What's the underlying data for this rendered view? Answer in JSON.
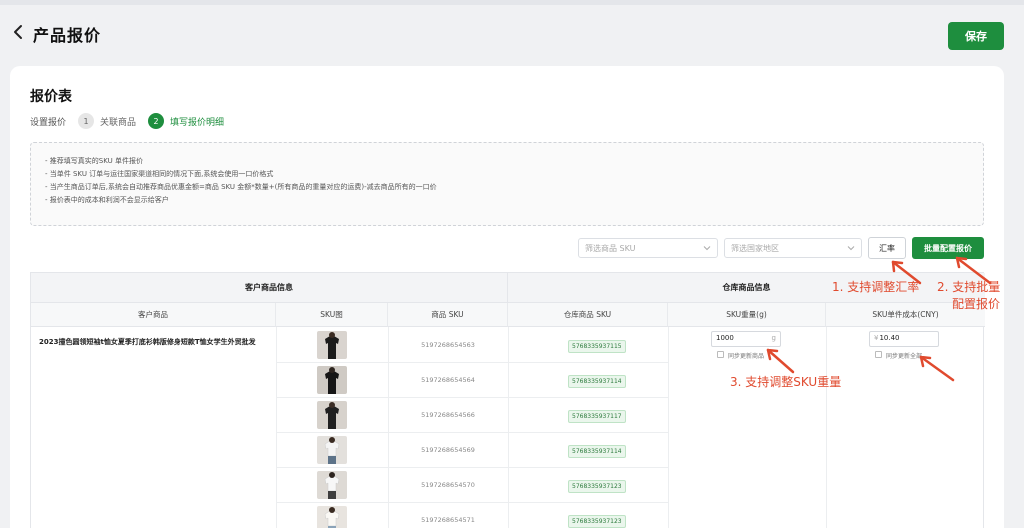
{
  "header": {
    "title": "产品报价",
    "save_label": "保存"
  },
  "card": {
    "title": "报价表",
    "steps": {
      "label": "设置报价",
      "items": [
        {
          "num": "1",
          "label": "关联商品"
        },
        {
          "num": "2",
          "label": "填写报价明细"
        }
      ]
    },
    "notes": [
      "- 推荐填写真实的SKU 单件报价",
      "- 当单件 SKU 订单与运往国家渠道相同的情况下面,系统会使用一口价格式",
      "- 当产生商品订单后,系统会自动推荐商品优惠金额=商品 SKU 金额*数量+(所有商品的重量对应的运费)-减去商品所有的一口价",
      "- 报价表中的成本和利润不会显示给客户"
    ],
    "filters": {
      "sku_placeholder": "筛选商品 SKU",
      "region_placeholder": "筛选国家地区",
      "rate_label": "汇率",
      "batch_label": "批量配置报价"
    }
  },
  "table": {
    "group_customer": "客户商品信息",
    "group_warehouse": "仓库商品信息",
    "columns": [
      "客户商品",
      "SKU图",
      "商品 SKU",
      "仓库商品 SKU",
      "SKU重量(g)",
      "SKU单件成本(CNY)"
    ],
    "product_name": "2023撞色圆领短袖t恤女夏季打底衫韩版修身短款T恤女学生外贸批发",
    "rows": [
      {
        "sku": "5197268654563",
        "wh_sku": "5768335937115"
      },
      {
        "sku": "5197268654564",
        "wh_sku": "5768335937114"
      },
      {
        "sku": "5197268654566",
        "wh_sku": "5768335937117"
      },
      {
        "sku": "5197268654569",
        "wh_sku": "5768335937114"
      },
      {
        "sku": "5197268654570",
        "wh_sku": "5768335937123"
      },
      {
        "sku": "5197268654571",
        "wh_sku": "5768335937123"
      }
    ],
    "weight_value": "1000",
    "weight_unit": "g",
    "cost_prefix": "¥",
    "cost_value": "10.40",
    "sync_weight_label": "同步更新商品",
    "sync_cost_label": "同步更新全部"
  },
  "annotations": {
    "a1": "1. 支持调整汇率",
    "a2_line1": "2. 支持批量",
    "a2_line2": "配置报价",
    "a3": "3. 支持调整SKU重量"
  },
  "colors": {
    "brand": "#1e8e3e",
    "annotation": "#e04a2e"
  }
}
